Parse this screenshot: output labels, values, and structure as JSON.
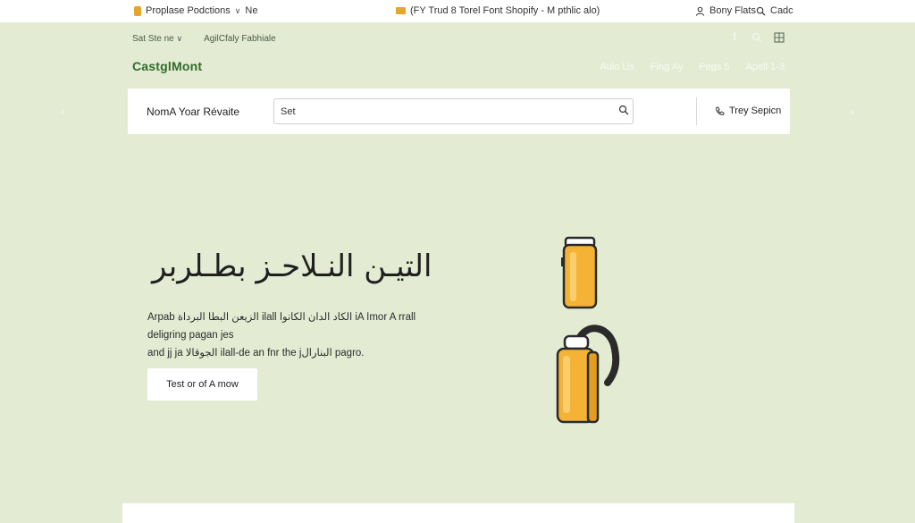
{
  "topbar": {
    "promo_label": "Proplase Podctions",
    "promo_suffix": "Ne",
    "announcement": "(FY Trud 8 Torel Font Shopify - M pthlic alo)",
    "account_label": "Bony Flats",
    "cart_label": "Cadc"
  },
  "subrow": {
    "left_label": "Sat Ste ne",
    "right_label": "AgilCfaly Fabhiale"
  },
  "logo": {
    "text": "CastglMont"
  },
  "nav": {
    "items": [
      "Aulo Us",
      "Fing Ay",
      "Pegs 5",
      "Apell 1-3"
    ]
  },
  "search_bar": {
    "label": "NomA Yoar Révaite",
    "input_value": "Set",
    "phone_label": "Trey Sepicn"
  },
  "hero": {
    "title": "التيـن النـلاحـز بطـلربر",
    "text_line1": "Arpab الزيعن البطا البرداة ilall الكاد الدان الكانوا iA اmor A rrall deligring pagan jes",
    "text_line2": "and jj ja الجوقالا ilall-de an fnr the jالبنارال pagro.",
    "button_label": "Test or of A mow"
  },
  "colors": {
    "background": "#e3ecd3",
    "accent": "#f4b336",
    "logo_green": "#2f6b2a"
  },
  "icons": [
    "tag-icon",
    "mail-icon",
    "user-icon",
    "search-icon",
    "facebook-icon",
    "phone-icon",
    "chevron-left-icon",
    "chevron-right-icon"
  ]
}
